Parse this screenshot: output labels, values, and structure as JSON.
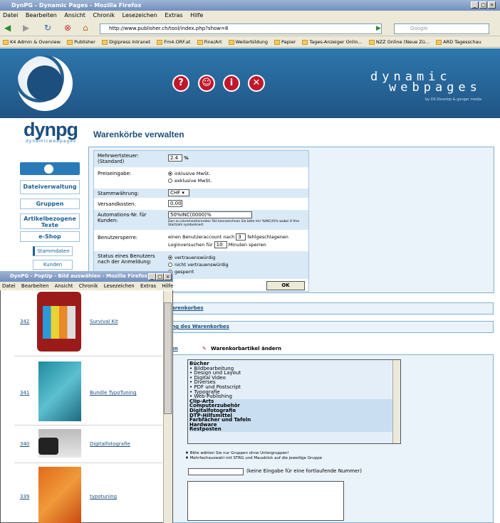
{
  "browser": {
    "title": "DynPG - Dynamic Pages - Mozilla Firefox",
    "menu": [
      "Datei",
      "Bearbeiten",
      "Ansicht",
      "Chronik",
      "Lesezeichen",
      "Extras",
      "Hilfe"
    ],
    "url": "http://www.publisher.ch/tool/index.php?show=8",
    "search_placeholder": "Google",
    "bookmarks": [
      "K4 Admin & Overview",
      "Publisher",
      "Digipress Intranet",
      "Fm4.ORF.at",
      "Fine/Art",
      "Weiterbildung",
      "Papier",
      "Tages-Anzeiger Onlin...",
      "NZZ Online (Neue Zü...",
      "ARD Tagesschau"
    ]
  },
  "header": {
    "brand_line1": "dynamic",
    "brand_line2": "webpages",
    "brand_sub": "by DS-Develop & ganger media",
    "logo": "dynpg",
    "logo_sub": "dynamicwebpages",
    "icons": [
      "?",
      "☺",
      "i",
      "✕"
    ]
  },
  "page_title": "Warenkörbe verwalten",
  "sidebar": {
    "items": [
      "Dateiverwaltung",
      "Gruppen",
      "Artikelbezogene Texte",
      "e-Shop"
    ],
    "subitems": [
      "Stammdaten",
      "Kunden"
    ]
  },
  "form": {
    "mwst_label": "Mehrwertsteuer: (Standard)",
    "mwst_value": "2.4",
    "mwst_unit": "%",
    "preis_label": "Preiseingabe:",
    "preis_opt1": "inklusive MwSt.",
    "preis_opt2": "exklusive MwSt.",
    "waehrung_label": "Stammwährung:",
    "waehrung_value": "CHF",
    "versand_label": "Versandkosten:",
    "versand_value": "0.00",
    "auto_label": "Automations-Nr. für Kunden:",
    "auto_value": "50%INC(0000)%",
    "auto_hint": "Den zu inkrementierenden Teil kennzeichnen Sie bitte mir %INC(X)% wobei X Ihre Startzahl symbolisiert.",
    "sperre_label": "Benutzersperre:",
    "sperre_text1": "einen Benutzeraccount nach",
    "sperre_value1": "3",
    "sperre_text2": "fehlgeschlagenen",
    "sperre_text3": "Loginversuchen für",
    "sperre_value2": "10",
    "sperre_text4": "Minuten sperren",
    "status_label": "Status eines Benutzers nach der Anmeldung:",
    "status_opt1": "vertrauenswürdig",
    "status_opt2": "nicht vertrauenswürdig",
    "status_opt3": "gesperrt",
    "ok": "OK"
  },
  "sections": {
    "bar1": "arenkorbes",
    "bar2": "ng des Warenkorbes",
    "tab_left": "en",
    "tab_right": "Warenkorbartikel ändern"
  },
  "listbox": {
    "head": "Bücher",
    "sub": [
      "• Bildbearbeitung",
      "• Design und Layout",
      "• Digital Video",
      "• Diverses",
      "• PDF und Postscript",
      "• Typografie",
      "• Web-Publishing"
    ],
    "rest": [
      "Clip-Arts",
      "Computerzubehör",
      "Digitalfotografie",
      "DTP-Hilfsmittel",
      "Farbfächer und Tafeln",
      "Hardware",
      "Restposten"
    ]
  },
  "hints": {
    "h1": "Bitte wählen Sie nur Gruppen ohne Untergruppen!",
    "h2": "Mehrfachauswahl mit STRG und Mausklick auf die jeweilige Gruppe",
    "nr": "(keine Eingabe für eine fortlaufende Nummer)"
  },
  "popup": {
    "title": "DynPG - PopUp - Bild auswählen - Mozilla Firefox",
    "menu": [
      "Datei",
      "Bearbeiten",
      "Ansicht",
      "Chronik",
      "Lesezeichen",
      "Extras",
      "Hilfe"
    ],
    "rows": [
      {
        "num": "342",
        "name": "Survival Kit"
      },
      {
        "num": "341",
        "name": "Bundle TypoTuning"
      },
      {
        "num": "340",
        "name": "Digitalfotografie"
      },
      {
        "num": "339",
        "name": "typotuning"
      }
    ]
  }
}
